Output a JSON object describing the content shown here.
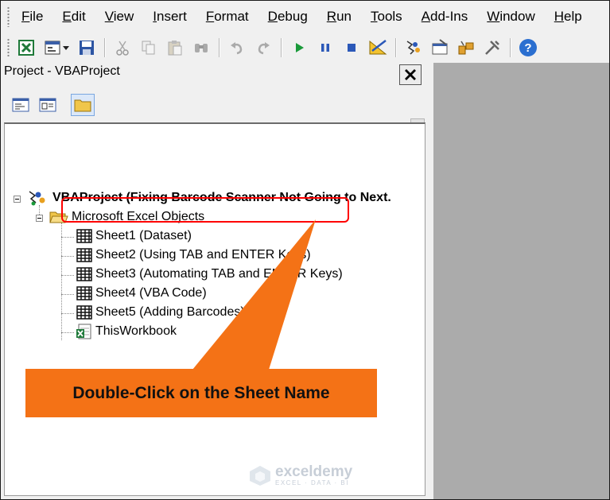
{
  "menubar": {
    "items": [
      {
        "label": "File"
      },
      {
        "label": "Edit"
      },
      {
        "label": "View"
      },
      {
        "label": "Insert"
      },
      {
        "label": "Format"
      },
      {
        "label": "Debug"
      },
      {
        "label": "Run"
      },
      {
        "label": "Tools"
      },
      {
        "label": "Add-Ins"
      },
      {
        "label": "Window"
      },
      {
        "label": "Help"
      }
    ]
  },
  "toolbar": {
    "icons": [
      "excel-icon",
      "insert-userform-icon",
      "save-icon",
      "cut-icon",
      "copy-icon",
      "paste-icon",
      "find-icon",
      "undo-icon",
      "redo-icon",
      "run-icon",
      "break-icon",
      "reset-icon",
      "design-mode-icon",
      "project-explorer-icon",
      "properties-icon",
      "object-browser-icon",
      "toolbox-icon",
      "help-icon"
    ]
  },
  "project_pane": {
    "title": "Project - VBAProject",
    "close_glyph": "✕"
  },
  "tree": {
    "root": "VBAProject (Fixing Barcode Scanner Not Going to Next.",
    "folder": "Microsoft Excel Objects",
    "items": [
      {
        "label": "Sheet1 (Dataset)",
        "icon": "worksheet-icon"
      },
      {
        "label": "Sheet2 (Using TAB and ENTER Keys)",
        "icon": "worksheet-icon"
      },
      {
        "label": "Sheet3 (Automating TAB and ENTER Keys)",
        "icon": "worksheet-icon"
      },
      {
        "label": "Sheet4 (VBA Code)",
        "icon": "worksheet-icon"
      },
      {
        "label": "Sheet5 (Adding Barcodes)",
        "icon": "worksheet-icon"
      },
      {
        "label": "ThisWorkbook",
        "icon": "workbook-icon"
      }
    ]
  },
  "annotation": {
    "callout_text": "Double-Click on the Sheet Name",
    "highlight_color": "#ff0000",
    "callout_color": "#f47216"
  },
  "watermark": {
    "brand": "exceldemy",
    "tagline": "EXCEL · DATA · BI"
  }
}
